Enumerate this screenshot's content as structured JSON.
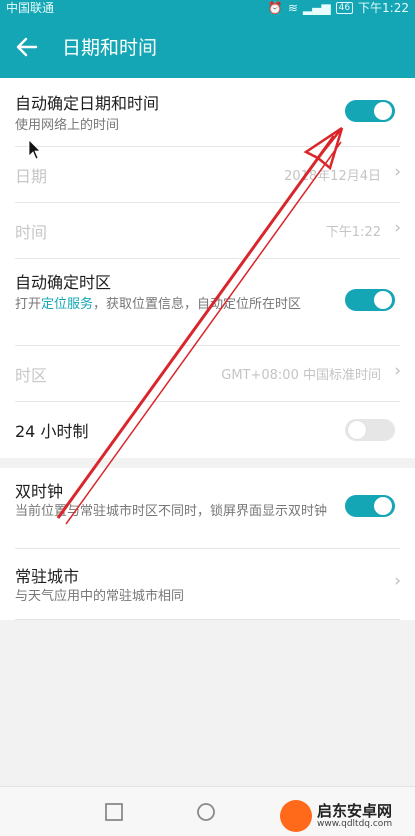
{
  "status": {
    "carrier": "中国联通",
    "battery": "46",
    "time": "下午1:22"
  },
  "appbar": {
    "title": "日期和时间"
  },
  "settings": {
    "auto_datetime": {
      "label": "自动确定日期和时间",
      "sub": "使用网络上的时间",
      "on": true
    },
    "date": {
      "label": "日期",
      "value": "2018年12月4日"
    },
    "time": {
      "label": "时间",
      "value": "下午1:22"
    },
    "auto_timezone": {
      "label": "自动确定时区",
      "sub_pre": "打开",
      "sub_link": "定位服务",
      "sub_post": "，获取位置信息，自动定位所在时区",
      "on": true
    },
    "timezone": {
      "label": "时区",
      "value": "GMT+08:00 中国标准时间"
    },
    "hour24": {
      "label": "24 小时制",
      "on": false
    },
    "dual_clock": {
      "label": "双时钟",
      "sub": "当前位置与常驻城市时区不同时，锁屏界面显示双时钟",
      "on": true
    },
    "home_city": {
      "label": "常驻城市",
      "sub": "与天气应用中的常驻城市相同"
    }
  },
  "icons": {
    "back": "back-arrow-icon",
    "chevron": "chevron-right-icon"
  },
  "watermark": {
    "name": "启东安卓网",
    "url": "www.qdltdq.com"
  },
  "colors": {
    "accent": "#14a6b5",
    "arrow": "#d9262b"
  }
}
